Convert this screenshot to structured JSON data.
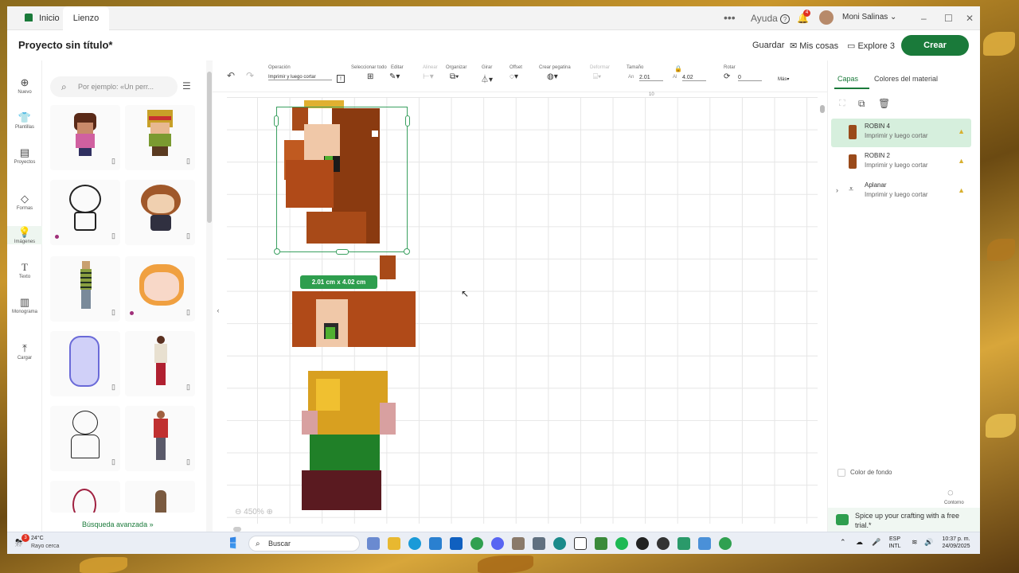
{
  "titlebar": {
    "tabs": [
      "Inicio",
      "Lienzo"
    ],
    "help": "Ayuda",
    "notif_count": "4",
    "user": "Moni Salinas"
  },
  "header": {
    "project": "Proyecto sin título*",
    "save": "Guardar",
    "my_stuff": "Mis cosas",
    "machine": "Explore 3",
    "create": "Crear"
  },
  "rail": [
    {
      "label": "Nuevo",
      "icon": "plus-icon"
    },
    {
      "label": "Plantillas",
      "icon": "shirt-icon"
    },
    {
      "label": "Proyectos",
      "icon": "projects-icon"
    },
    {
      "label": "Formas",
      "icon": "shapes-icon"
    },
    {
      "label": "Imágenes",
      "icon": "bulb-icon"
    },
    {
      "label": "Texto",
      "icon": "text-icon"
    },
    {
      "label": "Monograma",
      "icon": "monogram-icon"
    },
    {
      "label": "Cargar",
      "icon": "upload-icon"
    }
  ],
  "images": {
    "search_placeholder": "Por ejemplo: «Un perr...",
    "advanced": "Búsqueda avanzada"
  },
  "toolbar": {
    "operacion": "Operación",
    "operacion_val": "Imprimir y luego cortar",
    "seleccionar": "Seleccionar todo",
    "editar": "Editar",
    "alinear": "Alinear",
    "organizar": "Organizar",
    "girar": "Girar",
    "offset": "Offset",
    "pegatina": "Crear pegatina",
    "deformar": "Deformar",
    "tamano": "Tamaño",
    "an_label": "An",
    "an_val": "2.01",
    "al_label": "Al",
    "al_val": "4.02",
    "rotar": "Rotar",
    "rotar_val": "0",
    "mas": "Más"
  },
  "canvas": {
    "ruler_mark": "10",
    "size_badge": "2.01 cm x 4.02 cm",
    "zoom": "450%"
  },
  "rpanel": {
    "tab_layers": "Capas",
    "tab_colors": "Colores del material",
    "layers": [
      {
        "name": "ROBIN 4",
        "sub": "Imprimir y luego cortar",
        "selected": true
      },
      {
        "name": "ROBIN 2",
        "sub": "Imprimir y luego cortar",
        "selected": false
      },
      {
        "name": "Aplanar",
        "sub": "Imprimir y luego cortar",
        "selected": false
      }
    ],
    "bg_color": "Color de fondo",
    "contour": "Contorno",
    "promo": "Spice up your crafting with a free trial.*"
  },
  "taskbar": {
    "temp": "24°C",
    "weather": "Rayo cerca",
    "weather_badge": "3",
    "search": "Buscar",
    "lang1": "ESP",
    "lang2": "INTL",
    "time": "10:37 p. m.",
    "date": "24/09/2025"
  }
}
